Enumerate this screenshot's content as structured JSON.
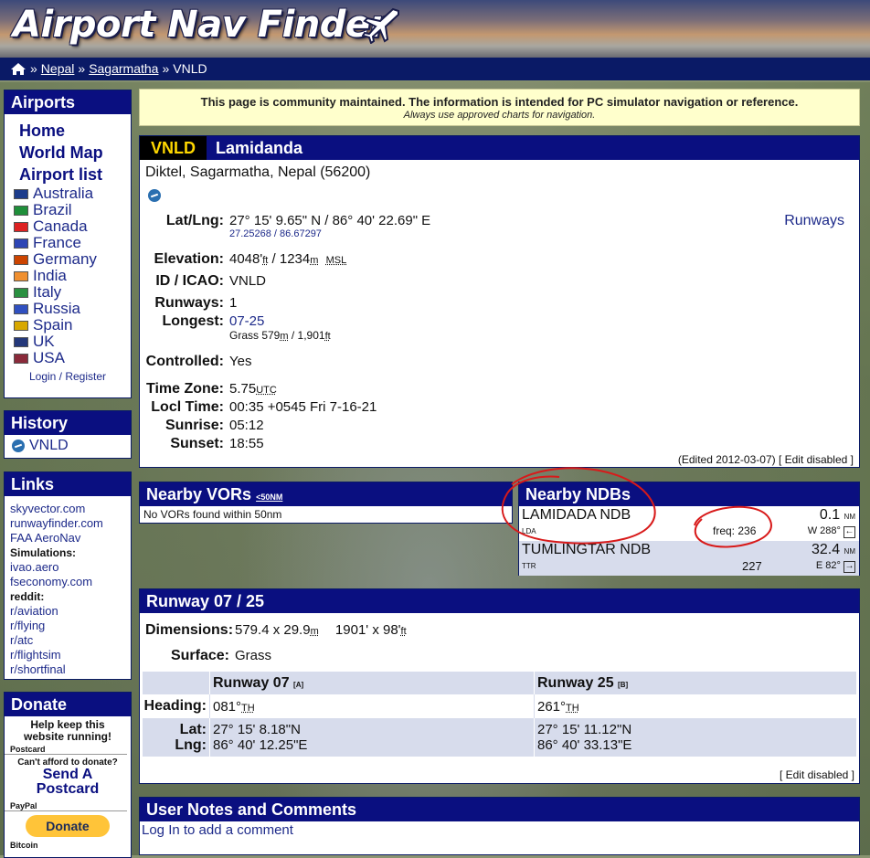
{
  "site": {
    "title": "Airport Nav Finder"
  },
  "breadcrumb": {
    "items": [
      "Nepal",
      "Sagarmatha"
    ],
    "current": "VNLD"
  },
  "sidebar": {
    "airports_title": "Airports",
    "nav": [
      "Home",
      "World Map",
      "Airport list"
    ],
    "countries": [
      {
        "name": "Australia",
        "flag": "#1c3c8c"
      },
      {
        "name": "Brazil",
        "flag": "#1f8f3a"
      },
      {
        "name": "Canada",
        "flag": "#d22"
      },
      {
        "name": "France",
        "flag": "#2d45b5"
      },
      {
        "name": "Germany",
        "flag": "#c40"
      },
      {
        "name": "India",
        "flag": "#f09030"
      },
      {
        "name": "Italy",
        "flag": "#2a9040"
      },
      {
        "name": "Russia",
        "flag": "#3050c0"
      },
      {
        "name": "Spain",
        "flag": "#d8a800"
      },
      {
        "name": "UK",
        "flag": "#24387a"
      },
      {
        "name": "USA",
        "flag": "#8a2a3a"
      }
    ],
    "login": "Login / Register",
    "history_title": "History",
    "history_item": "VNLD",
    "links_title": "Links",
    "links_top": [
      "skyvector.com",
      "runwayfinder.com",
      "FAA AeroNav"
    ],
    "simulations_label": "Simulations:",
    "simulations": [
      "ivao.aero",
      "fseconomy.com"
    ],
    "reddit_label": "reddit:",
    "reddit": [
      "r/aviation",
      "r/flying",
      "r/atc",
      "r/flightsim",
      "r/shortfinal"
    ],
    "donate_title": "Donate",
    "donate_text": "Help keep this website running!",
    "postcard_label": "Postcard",
    "cant_afford": "Can't afford to donate?",
    "send_postcard": "Send A Postcard",
    "paypal_label": "PayPal",
    "donate_button": "Donate",
    "bitcoin_label": "Bitcoin"
  },
  "notice": {
    "line1": "This page is community maintained. The information is intended for PC simulator navigation or reference.",
    "line2": "Always use approved charts for navigation."
  },
  "airport": {
    "icao": "VNLD",
    "name": "Lamidanda",
    "location": "Diktel, Sagarmatha, Nepal (56200)",
    "runways_link": "Runways",
    "latlng_label": "Lat/Lng:",
    "latlng": "27° 15' 9.65\" N / 86° 40' 22.69\" E",
    "latlng_decimal": "27.25268 / 86.67297",
    "elevation_label": "Elevation:",
    "elev_ft": "4048'",
    "elev_ft_unit": "ft",
    "elev_sep": "/ 1234",
    "elev_m_unit": "m",
    "elev_msl": "MSL",
    "id_label": "ID / ICAO:",
    "id": "VNLD",
    "runways_label": "Runways:",
    "runways": "1",
    "longest_label": "Longest:",
    "longest": "07-25",
    "longest_detail_a": "Grass 579",
    "longest_detail_m": "m",
    "longest_detail_b": "/ 1,901",
    "longest_detail_ft": "ft",
    "controlled_label": "Controlled:",
    "controlled": "Yes",
    "tz_label": "Time Zone:",
    "tz": "5.75",
    "tz_unit": "UTC",
    "local_label": "Locl Time:",
    "local": "00:35 +0545 Fri 7-16-21",
    "sunrise_label": "Sunrise:",
    "sunrise": "05:12",
    "sunset_label": "Sunset:",
    "sunset": "18:55",
    "edited": "(Edited 2012-03-07) [ Edit disabled ]"
  },
  "vors": {
    "title": "Nearby VORs",
    "title_sub": "<50NM",
    "empty": "No VORs found within 50nm"
  },
  "ndbs": {
    "title": "Nearby NDBs",
    "rows": [
      {
        "name": "LAMIDADA NDB",
        "dist": "0.1",
        "unit": "NM",
        "ident": "LDA",
        "freq": "freq: 236",
        "bearing": "W 288°",
        "arrow": "←"
      },
      {
        "name": "TUMLINGTAR NDB",
        "dist": "32.4",
        "unit": "NM",
        "ident": "TTR",
        "freq": "227",
        "bearing": "E 82°",
        "arrow": "→"
      }
    ]
  },
  "runway": {
    "title": "Runway 07 / 25",
    "dims_label": "Dimensions:",
    "dims_m": "579.4 x 29.9",
    "dims_m_unit": "m",
    "dims_ft": "1901' x 98'",
    "dims_ft_unit": "ft",
    "surface_label": "Surface:",
    "surface": "Grass",
    "col_a": "Runway 07",
    "col_a_tag": "[A]",
    "col_b": "Runway 25",
    "col_b_tag": "[B]",
    "heading_label": "Heading:",
    "heading_a": "081°",
    "heading_b": "261°",
    "heading_unit": "TH",
    "lat_label": "Lat:",
    "lng_label": "Lng:",
    "lat_a": "27° 15' 8.18\"N",
    "lng_a": "86° 40' 12.25\"E",
    "lat_b": "27° 15' 11.12\"N",
    "lng_b": "86° 40' 33.13\"E",
    "edit": "[ Edit disabled ]"
  },
  "notes": {
    "title": "User Notes and Comments",
    "login": "Log In to add a comment"
  },
  "annotations": {
    "color": "#d81a1a"
  }
}
